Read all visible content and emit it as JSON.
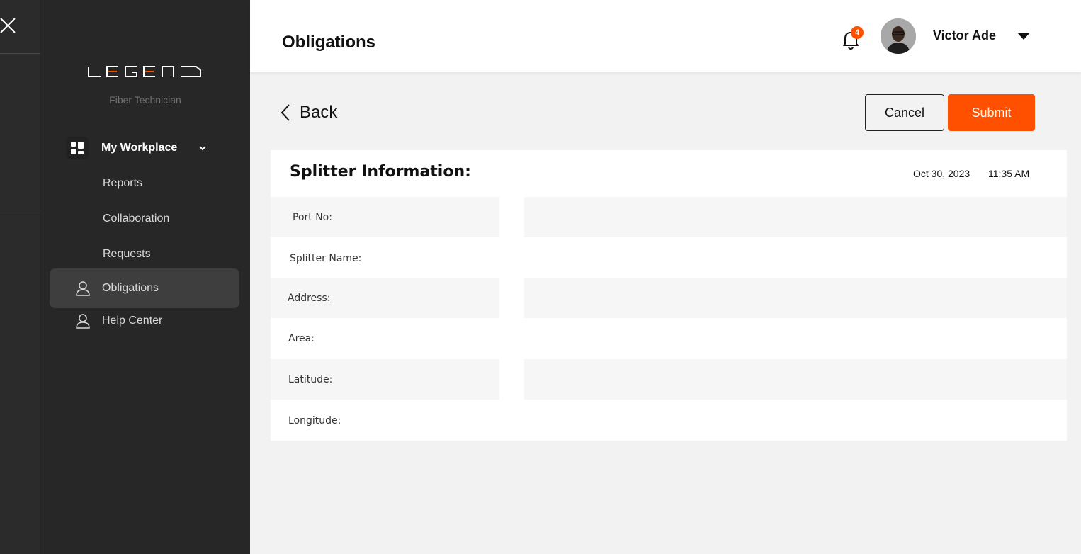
{
  "app": {
    "logo_text": "LEGEND",
    "role": "Fiber Technician"
  },
  "sidebar": {
    "section_label": "My Workplace",
    "sub_items": [
      "Reports",
      "Collaboration",
      "Requests"
    ],
    "items": [
      {
        "label": "Obligations",
        "icon": "user-icon",
        "active": true
      },
      {
        "label": "Help Center",
        "icon": "user-icon",
        "active": false
      }
    ]
  },
  "header": {
    "title": "Obligations",
    "notification_count": "4",
    "user_name": "Victor Ade"
  },
  "actions": {
    "back_label": "Back",
    "cancel_label": "Cancel",
    "submit_label": "Submit"
  },
  "card": {
    "title": "Splitter Information:",
    "date": "Oct 30, 2023",
    "time": "11:35 AM",
    "fields": [
      {
        "label": "Port No:",
        "value": ""
      },
      {
        "label": "Splitter Name:",
        "value": ""
      },
      {
        "label": "Address:",
        "value": ""
      },
      {
        "label": "Area:",
        "value": ""
      },
      {
        "label": "Latitude:",
        "value": ""
      },
      {
        "label": "Longitude:",
        "value": ""
      }
    ]
  },
  "colors": {
    "accent": "#ff5000",
    "sidebar_bg": "#272727",
    "page_bg": "#f2f2f2"
  }
}
